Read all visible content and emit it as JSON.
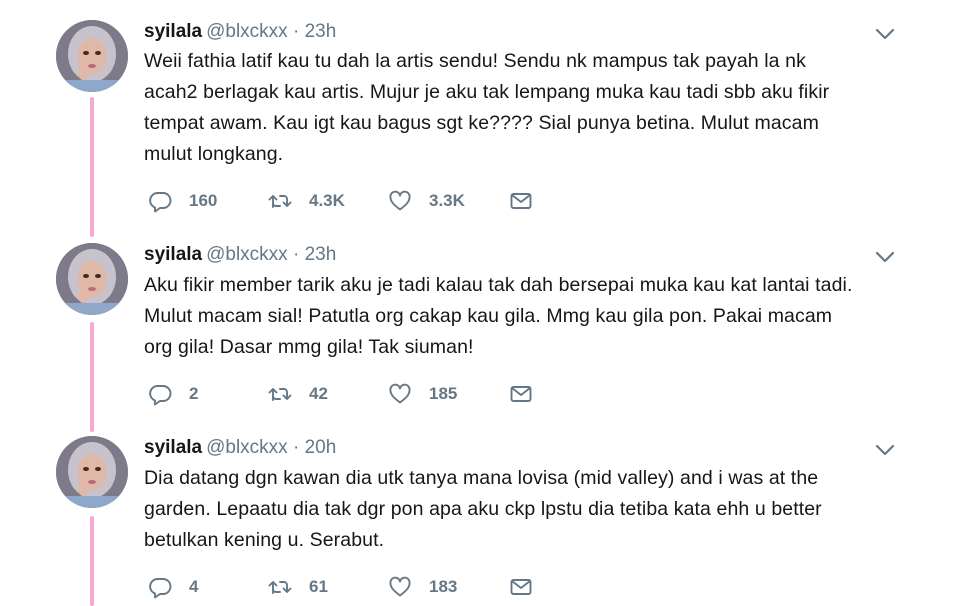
{
  "tweets": [
    {
      "name": "syilala",
      "handle": "@blxckxx",
      "separator": "·",
      "time": "23h",
      "lines": [
        "Weii fathia latif kau tu dah la artis sendu! Sendu nk mampus tak payah la nk",
        "acah2 berlagak kau artis. Mujur je aku tak lempang muka kau tadi sbb aku fikir",
        "tempat awam. Kau igt kau bagus sgt ke???? Sial punya betina. Mulut macam",
        "mulut longkang."
      ],
      "replies": "160",
      "retweets": "4.3K",
      "likes": "3.3K"
    },
    {
      "name": "syilala",
      "handle": "@blxckxx",
      "separator": "·",
      "time": "23h",
      "lines": [
        "Aku fikir member tarik aku je tadi kalau tak dah bersepai muka kau kat lantai tadi.",
        "Mulut macam sial! Patutla org cakap kau gila. Mmg kau gila pon. Pakai macam",
        "org gila! Dasar mmg gila! Tak siuman!"
      ],
      "replies": "2",
      "retweets": "42",
      "likes": "185"
    },
    {
      "name": "syilala",
      "handle": "@blxckxx",
      "separator": "·",
      "time": "20h",
      "lines": [
        "Dia datang dgn kawan dia utk tanya mana lovisa (mid valley) and i was at the",
        "garden. Lepaatu dia tak dgr pon apa aku ckp lpstu dia tetiba kata ehh u better",
        "betulkan kening u. Serabut."
      ],
      "replies": "4",
      "retweets": "61",
      "likes": "183"
    }
  ],
  "colors": {
    "thread_line": "#f7a6d8",
    "secondary_text": "#657786",
    "primary_text": "#14171a"
  },
  "icons": {
    "reply": "reply-icon",
    "retweet": "retweet-icon",
    "like": "like-icon",
    "dm": "envelope-icon",
    "more": "chevron-down-icon"
  }
}
